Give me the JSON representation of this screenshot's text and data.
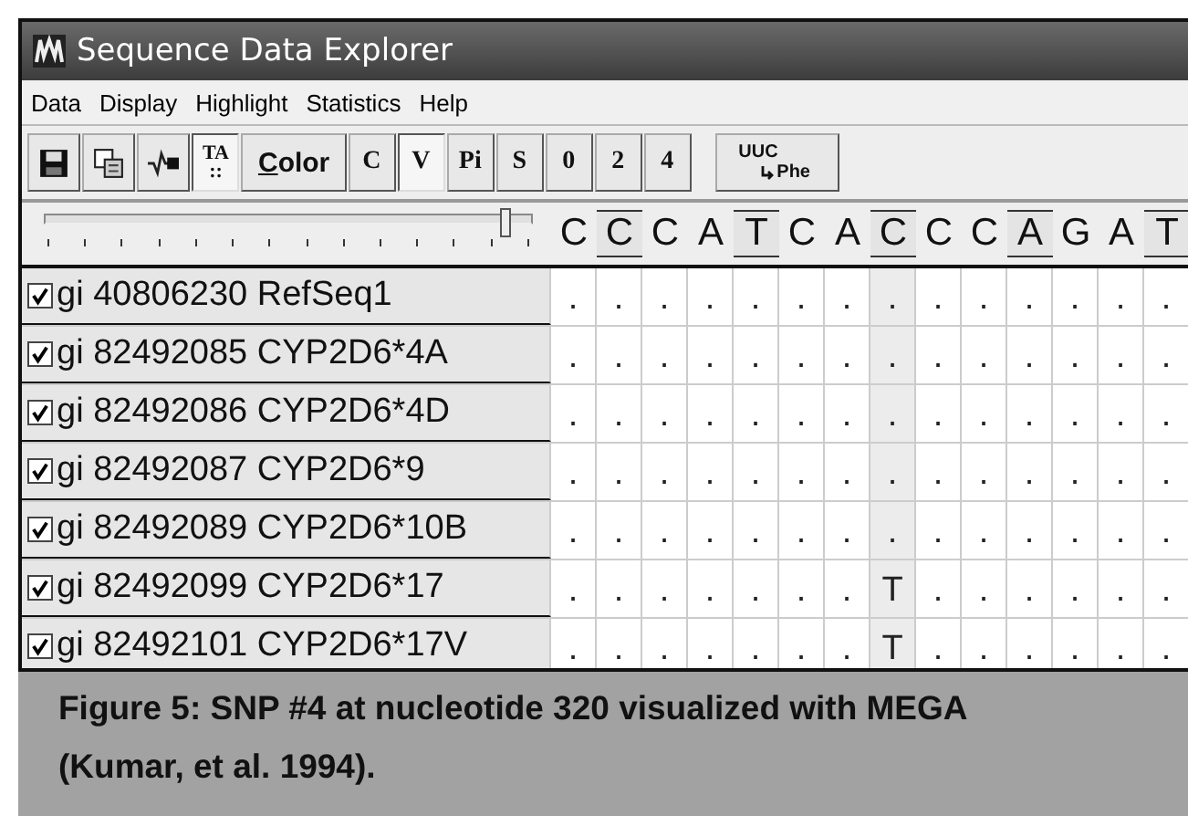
{
  "window": {
    "title": "Sequence Data Explorer"
  },
  "menu": [
    "Data",
    "Display",
    "Highlight",
    "Statistics",
    "Help"
  ],
  "toolbar": [
    {
      "kind": "save",
      "pressed": false
    },
    {
      "kind": "copy",
      "pressed": false
    },
    {
      "kind": "variable",
      "pressed": false
    },
    {
      "kind": "stack",
      "top": "TA",
      "bottom": "::",
      "pressed": true
    },
    {
      "kind": "text",
      "label": "Color",
      "pressed": false
    },
    {
      "kind": "serif",
      "label": "C",
      "pressed": false
    },
    {
      "kind": "serif",
      "label": "V",
      "pressed": true
    },
    {
      "kind": "serif",
      "label": "Pi",
      "pressed": false
    },
    {
      "kind": "serif",
      "label": "S",
      "pressed": false
    },
    {
      "kind": "serif",
      "label": "0",
      "pressed": false
    },
    {
      "kind": "serif",
      "label": "2",
      "pressed": false
    },
    {
      "kind": "serif",
      "label": "4",
      "pressed": false
    },
    {
      "kind": "codon",
      "top": "UUC",
      "bottom": "Phe",
      "pressed": false
    }
  ],
  "slider": {
    "level": 0.95
  },
  "header": [
    {
      "base": "C",
      "marked": false
    },
    {
      "base": "C",
      "marked": true
    },
    {
      "base": "C",
      "marked": false
    },
    {
      "base": "A",
      "marked": false
    },
    {
      "base": "T",
      "marked": true
    },
    {
      "base": "C",
      "marked": false
    },
    {
      "base": "A",
      "marked": false
    },
    {
      "base": "C",
      "marked": true,
      "highlighted": true
    },
    {
      "base": "C",
      "marked": false
    },
    {
      "base": "C",
      "marked": false
    },
    {
      "base": "A",
      "marked": true
    },
    {
      "base": "G",
      "marked": false
    },
    {
      "base": "A",
      "marked": false
    },
    {
      "base": "T",
      "marked": true
    }
  ],
  "rows": [
    {
      "name": "gi 40806230 RefSeq1",
      "checked": true,
      "cells": [
        ".",
        ".",
        ".",
        ".",
        ".",
        ".",
        ".",
        ".",
        ".",
        ".",
        ".",
        ".",
        ".",
        "."
      ]
    },
    {
      "name": "gi 82492085 CYP2D6*4A",
      "checked": true,
      "cells": [
        ".",
        ".",
        ".",
        ".",
        ".",
        ".",
        ".",
        ".",
        ".",
        ".",
        ".",
        ".",
        ".",
        "."
      ]
    },
    {
      "name": "gi 82492086 CYP2D6*4D",
      "checked": true,
      "cells": [
        ".",
        ".",
        ".",
        ".",
        ".",
        ".",
        ".",
        ".",
        ".",
        ".",
        ".",
        ".",
        ".",
        "."
      ]
    },
    {
      "name": "gi 82492087 CYP2D6*9",
      "checked": true,
      "cells": [
        ".",
        ".",
        ".",
        ".",
        ".",
        ".",
        ".",
        ".",
        ".",
        ".",
        ".",
        ".",
        ".",
        "."
      ]
    },
    {
      "name": "gi 82492089 CYP2D6*10B",
      "checked": true,
      "cells": [
        ".",
        ".",
        ".",
        ".",
        ".",
        ".",
        ".",
        ".",
        ".",
        ".",
        ".",
        ".",
        ".",
        "."
      ]
    },
    {
      "name": "gi 82492099 CYP2D6*17",
      "checked": true,
      "cells": [
        ".",
        ".",
        ".",
        ".",
        ".",
        ".",
        ".",
        "T",
        ".",
        ".",
        ".",
        ".",
        ".",
        "."
      ]
    },
    {
      "name": "gi 82492101 CYP2D6*17V",
      "checked": true,
      "cells": [
        ".",
        ".",
        ".",
        ".",
        ".",
        ".",
        ".",
        "T",
        ".",
        ".",
        ".",
        ".",
        ".",
        "."
      ]
    }
  ],
  "caption": [
    "Figure 5: SNP #4 at nucleotide 320 visualized with MEGA",
    "(Kumar, et al. 1994)."
  ]
}
